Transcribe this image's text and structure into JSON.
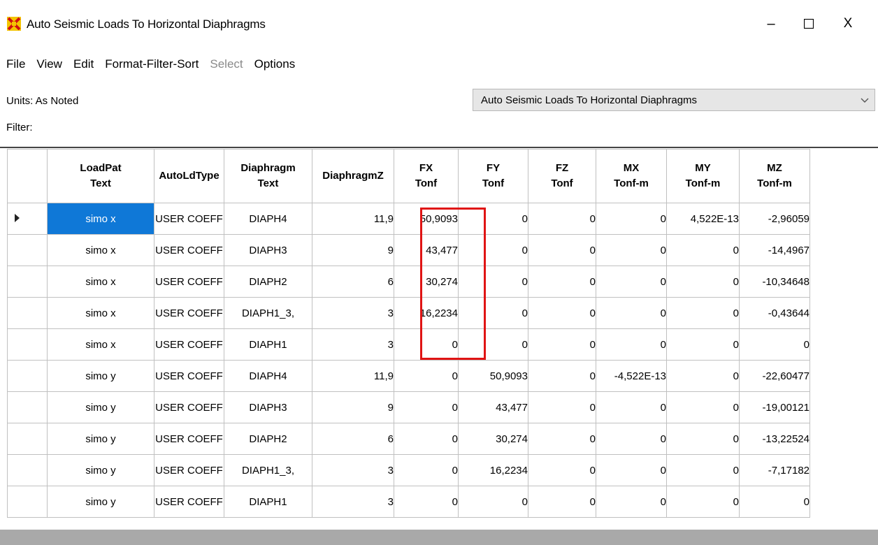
{
  "window": {
    "title": "Auto Seismic Loads To Horizontal Diaphragms",
    "minimize_glyph": "–",
    "maximize_glyph": "☐",
    "close_glyph": "X"
  },
  "menu": [
    {
      "label": "File",
      "enabled": true
    },
    {
      "label": "View",
      "enabled": true
    },
    {
      "label": "Edit",
      "enabled": true
    },
    {
      "label": "Format-Filter-Sort",
      "enabled": true
    },
    {
      "label": "Select",
      "enabled": false
    },
    {
      "label": "Options",
      "enabled": true
    }
  ],
  "info": {
    "units": "Units:  As Noted",
    "filter": "Filter:"
  },
  "table_selector": {
    "value": "Auto Seismic Loads To Horizontal Diaphragms",
    "icon": "chevron-down-icon"
  },
  "grid": {
    "headers": [
      [
        "LoadPat",
        "Text"
      ],
      [
        "AutoLdType",
        ""
      ],
      [
        "Diaphragm",
        "Text"
      ],
      [
        "DiaphragmZ",
        ""
      ],
      [
        "FX",
        "Tonf"
      ],
      [
        "FY",
        "Tonf"
      ],
      [
        "FZ",
        "Tonf"
      ],
      [
        "MX",
        "Tonf-m"
      ],
      [
        "MY",
        "Tonf-m"
      ],
      [
        "MZ",
        "Tonf-m"
      ]
    ],
    "rows": [
      [
        "simo x",
        "USER COEFF",
        "DIAPH4",
        "11,9",
        "50,9093",
        "0",
        "0",
        "0",
        "4,522E-13",
        "-2,96059"
      ],
      [
        "simo x",
        "USER COEFF",
        "DIAPH3",
        "9",
        "43,477",
        "0",
        "0",
        "0",
        "0",
        "-14,4967"
      ],
      [
        "simo x",
        "USER COEFF",
        "DIAPH2",
        "6",
        "30,274",
        "0",
        "0",
        "0",
        "0",
        "-10,34648"
      ],
      [
        "simo x",
        "USER COEFF",
        "DIAPH1_3,",
        "3",
        "16,2234",
        "0",
        "0",
        "0",
        "0",
        "-0,43644"
      ],
      [
        "simo x",
        "USER COEFF",
        "DIAPH1",
        "3",
        "0",
        "0",
        "0",
        "0",
        "0",
        "0"
      ],
      [
        "simo y",
        "USER COEFF",
        "DIAPH4",
        "11,9",
        "0",
        "50,9093",
        "0",
        "-4,522E-13",
        "0",
        "-22,60477"
      ],
      [
        "simo y",
        "USER COEFF",
        "DIAPH3",
        "9",
        "0",
        "43,477",
        "0",
        "0",
        "0",
        "-19,00121"
      ],
      [
        "simo y",
        "USER COEFF",
        "DIAPH2",
        "6",
        "0",
        "30,274",
        "0",
        "0",
        "0",
        "-13,22524"
      ],
      [
        "simo y",
        "USER COEFF",
        "DIAPH1_3,",
        "3",
        "0",
        "16,2234",
        "0",
        "0",
        "0",
        "-7,17182"
      ],
      [
        "simo y",
        "USER COEFF",
        "DIAPH1",
        "3",
        "0",
        "0",
        "0",
        "0",
        "0",
        "0"
      ]
    ],
    "selected_row": 0,
    "highlight_color": "#e01414",
    "selection_color": "#0f78d7"
  }
}
